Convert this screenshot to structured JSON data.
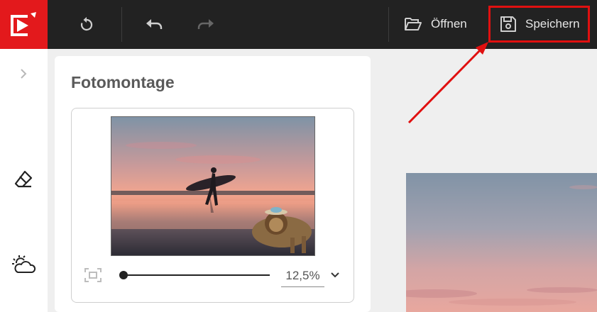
{
  "toolbar": {
    "logo": "app-logo",
    "open_label": "Öffnen",
    "save_label": "Speichern",
    "icons": [
      "reset-icon",
      "undo-icon",
      "redo-icon",
      "folder-open-icon",
      "floppy-disk-icon"
    ]
  },
  "sidebar": {
    "icons": [
      "chevron-right-icon",
      "eraser-icon",
      "sun-cloud-icon"
    ]
  },
  "panel": {
    "title": "Fotomontage",
    "zoom": {
      "value_label": "12,5%",
      "slider_fraction": 0
    }
  },
  "colors": {
    "brand": "#e3191c",
    "toolbar_bg": "#222222",
    "highlight": "#e01010"
  }
}
